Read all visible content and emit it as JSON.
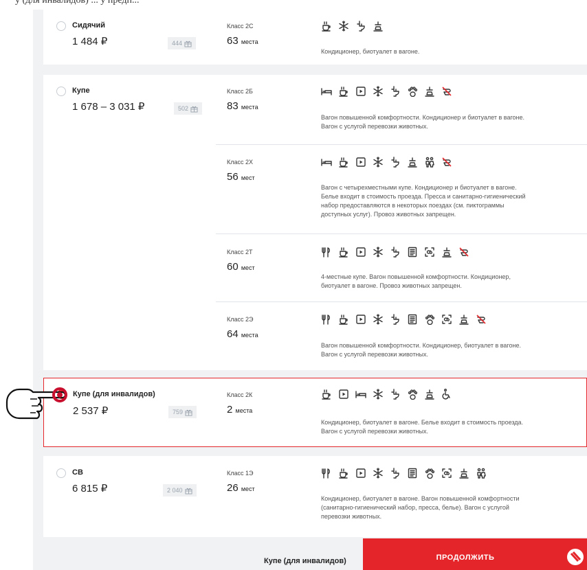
{
  "top_fragment": "у (для инвалидов) ... у предп...",
  "cars": [
    {
      "name": "Сидячий",
      "price": "1 484 ₽",
      "bonus": "444",
      "classes": [
        {
          "class": "Класс 2С",
          "seats_num": "63",
          "seats_word": "места",
          "icons": [
            "coffee-cup-icon",
            "snowflake-icon",
            "toilet-icon",
            "hygiene-icon"
          ],
          "desc": [
            "Кондиционер, биотуалет в вагоне."
          ]
        }
      ]
    },
    {
      "name": "Купе",
      "price": "1 678 – 3 031 ₽",
      "bonus": "502",
      "classes": [
        {
          "class": "Класс 2Б",
          "seats_num": "83",
          "seats_word": "места",
          "icons": [
            "bed-icon",
            "coffee-cup-icon",
            "video-icon",
            "snowflake-icon",
            "toilet-icon",
            "paw-icon",
            "hygiene-icon",
            "no-pets-icon"
          ],
          "desc": [
            "Вагон повышенной комфортности. Кондиционер и биотуалет в вагоне.",
            "Вагон с услугой перевозки животных."
          ]
        },
        {
          "class": "Класс 2Х",
          "seats_num": "56",
          "seats_word": "мест",
          "icons": [
            "bed-icon",
            "coffee-cup-icon",
            "video-icon",
            "snowflake-icon",
            "toilet-icon",
            "hygiene-icon",
            "people-icon",
            "no-pets-icon"
          ],
          "desc": [
            "Вагон с четырехместными купе. Кондиционер и биотуалет в вагоне.",
            "Белье входит в стоимость проезда. Пресса и санитарно-гигиенический",
            "набор предоставляются в некоторых поездах (см. пиктограммы",
            "доступных услуг). Провоз животных запрещен."
          ]
        },
        {
          "class": "Класс 2Т",
          "seats_num": "60",
          "seats_word": "мест",
          "icons": [
            "fork-knife-icon",
            "coffee-cup-icon",
            "video-icon",
            "snowflake-icon",
            "toilet-icon",
            "newspaper-icon",
            "cosmetics-icon",
            "hygiene-icon",
            "no-pets-icon"
          ],
          "desc": [
            "4-местные купе. Вагон повышенной комфортности. Кондиционер,",
            "биотуалет в вагоне. Провоз животных запрещен."
          ]
        },
        {
          "class": "Класс 2Э",
          "seats_num": "64",
          "seats_word": "места",
          "icons": [
            "fork-knife-icon",
            "coffee-cup-icon",
            "video-icon",
            "snowflake-icon",
            "toilet-icon",
            "newspaper-icon",
            "paw-icon",
            "cosmetics-icon",
            "hygiene-icon",
            "no-pets-icon"
          ],
          "desc": [
            "Вагон повышенной комфортности. Кондиционер, биотуалет в вагоне.",
            "Вагон с услугой перевозки животных."
          ]
        }
      ]
    },
    {
      "name": "Купе (для инвалидов)",
      "price": "2 537 ₽",
      "bonus": "759",
      "classes": [
        {
          "class": "Класс 2К",
          "seats_num": "2",
          "seats_word": "места",
          "icons": [
            "coffee-cup-icon",
            "video-icon",
            "bed-icon",
            "snowflake-icon",
            "toilet-icon",
            "paw-icon",
            "hygiene-icon",
            "wheelchair-icon"
          ],
          "desc": [
            "Кондиционер, биотуалет в вагоне. Белье входит в стоимость проезда.",
            "Вагон с услугой перевозки животных."
          ]
        }
      ]
    },
    {
      "name": "СВ",
      "price": "6 815 ₽",
      "bonus": "2 040",
      "classes": [
        {
          "class": "Класс 1Э",
          "seats_num": "26",
          "seats_word": "мест",
          "icons": [
            "fork-knife-icon",
            "coffee-cup-icon",
            "video-icon",
            "snowflake-icon",
            "toilet-icon",
            "newspaper-icon",
            "paw-icon",
            "cosmetics-icon",
            "hygiene-icon",
            "people-icon"
          ],
          "desc": [
            "Кондиционер, биотуалет в вагоне. Вагон повышенной комфортности",
            "(санитарно-гигиенический набор, пресса, белье). Вагон с услугой",
            "перевозки животных."
          ]
        }
      ]
    }
  ],
  "footer": {
    "selected": "Купе (для инвалидов)",
    "button": "ПРОДОЛЖИТЬ"
  },
  "colors": {
    "accent": "#e4262b",
    "bg": "#f1f2f4",
    "card": "#ffffff"
  }
}
